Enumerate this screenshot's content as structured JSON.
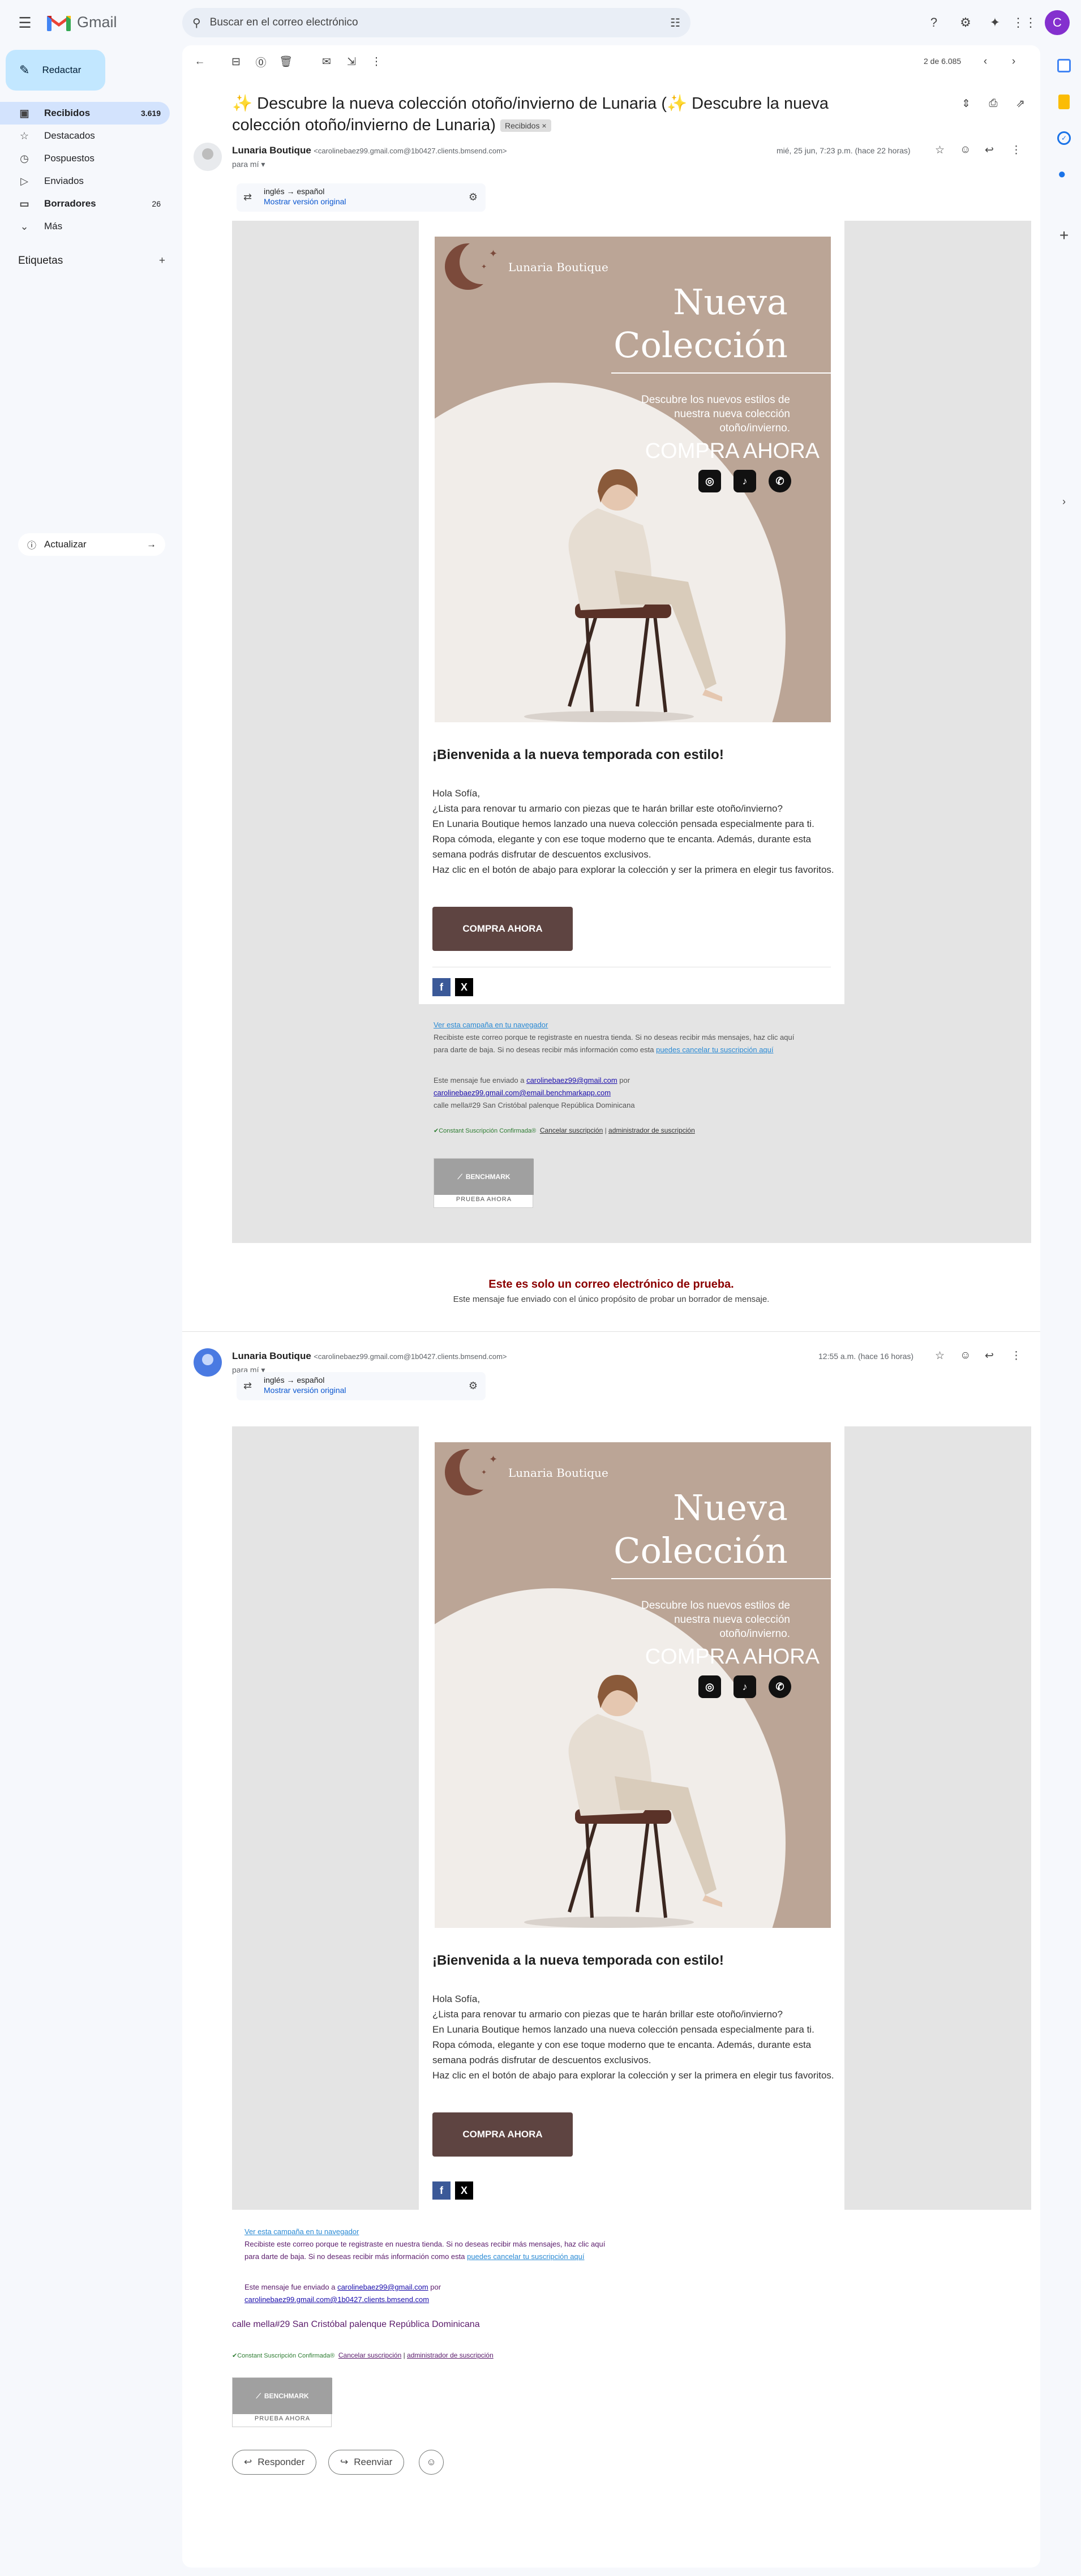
{
  "app": {
    "name": "Gmail",
    "avatar_letter": "C",
    "brand_colors": {
      "red": "#ea4335",
      "blue": "#4285f4",
      "green": "#34a853",
      "yellow": "#fbbc04"
    }
  },
  "search": {
    "placeholder": "Buscar en el correo electrónico"
  },
  "compose": {
    "label": "Redactar"
  },
  "nav": [
    {
      "label": "Recibidos",
      "count": "3.619",
      "icon": "inbox-icon",
      "active": true
    },
    {
      "label": "Destacados",
      "count": "",
      "icon": "star-icon"
    },
    {
      "label": "Pospuestos",
      "count": "",
      "icon": "clock-icon"
    },
    {
      "label": "Enviados",
      "count": "",
      "icon": "send-icon"
    },
    {
      "label": "Borradores",
      "count": "26",
      "icon": "draft-icon"
    },
    {
      "label": "Más",
      "count": "",
      "icon": "chevron-down-icon"
    }
  ],
  "labels": {
    "title": "Etiquetas"
  },
  "update": {
    "label": "Actualizar"
  },
  "toolbar": {
    "page_info": "2 de 6.085"
  },
  "email": {
    "subject": "✨ Descubre la nueva colección otoño/invierno de Lunaria (✨ Descubre la nueva colección otoño/invierno de Lunaria)",
    "badge": "Recibidos ×",
    "sender_name": "Lunaria Boutique",
    "sender_addr": "<carolinebaez99.gmail.com@1b0427.clients.bmsend.com>",
    "to": "para mí ▾",
    "translation": {
      "langs": "inglés → español",
      "link": "Mostrar versión original"
    },
    "messages": [
      {
        "time": "mié, 25 jun, 7:23 p.m. (hace 22 horas)"
      },
      {
        "time": "12:55 a.m. (hace 16 horas)"
      }
    ],
    "hero": {
      "brand": "Lunaria Boutique",
      "title_line1": "Nueva",
      "title_line2": "Colección",
      "desc": "Descubre los nuevos estilos de nuestra nueva colección otoño/invierno.",
      "cta": "COMPRA AHORA"
    },
    "welcome": "¡Bienvenida a la nueva temporada con estilo!",
    "body_lines": [
      "Hola Sofía,",
      "¿Lista para renovar tu armario con piezas que te harán brillar este otoño/invierno?",
      "En Lunaria Boutique hemos lanzado una nueva colección pensada especialmente para ti. Ropa cómoda, elegante y con ese toque moderno que te encanta. Además, durante esta semana podrás disfrutar de descuentos exclusivos.",
      "Haz clic en el botón de abajo para explorar la colección y ser la primera en elegir tus favoritos."
    ],
    "button": "COMPRA AHORA",
    "footer": {
      "view_online": "Ver esta campaña en tu navegador",
      "reason_1": "Recibiste este correo porque te registraste en nuestra tienda. Si no deseas recibir más mensajes, haz clic aquí",
      "reason_2": "para darte de baja. Si no deseas recibir más información como esta ",
      "unsub_link": "puedes cancelar tu suscripción aquí",
      "sent_to": "Este mensaje fue enviado a ",
      "email1": "carolinebaez99@gmail.com",
      "por": " por",
      "email2": "carolinebaez99.gmail.com@email.benchmarkapp.com",
      "email2b": "carolinebaez99.gmail.com@1b0427.clients.bmsend.com",
      "address": "calle mella#29 San Cristóbal palenque República Dominicana",
      "verified": "✔Constant Suscripción Confirmada®",
      "cancel": "Cancelar suscripción",
      "sep": " | ",
      "admin": "administrador de suscripción",
      "bench_top": "BENCHMARK",
      "bench_bot": "PRUEBA AHORA"
    },
    "test_title": "Este es solo un correo electrónico de prueba.",
    "test_text": "Este mensaje fue enviado con el único propósito de probar un borrador de mensaje."
  },
  "actions": {
    "reply": "Responder",
    "forward": "Reenviar"
  }
}
